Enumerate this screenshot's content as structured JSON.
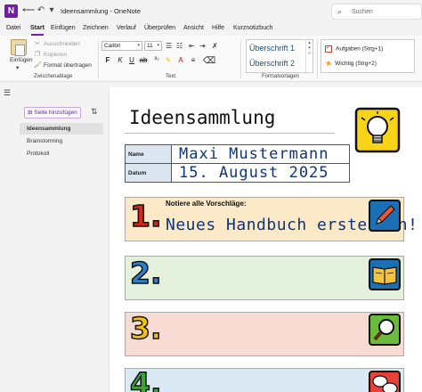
{
  "window": {
    "doc_title": "Ideensammlung - OneNote",
    "search_placeholder": "Suchen"
  },
  "menu": [
    "Datei",
    "Start",
    "Einfügen",
    "Zeichnen",
    "Verlauf",
    "Überprüfen",
    "Ansicht",
    "Hilfe",
    "Kurznotizbuch"
  ],
  "ribbon": {
    "clipboard": {
      "paste": "Einfügen",
      "cut": "Ausschneiden",
      "copy": "Kopieren",
      "format_painter": "Format übertragen",
      "label": "Zwischenablage"
    },
    "text": {
      "font": "Calibri",
      "size": "11",
      "label": "Text"
    },
    "styles": {
      "h1": "Überschrift 1",
      "h2": "Überschrift 2",
      "label": "Formatvorlagen"
    },
    "tags": {
      "todo": "Aufgaben (Strg+1)",
      "important": "Wichtig (Strg+2)"
    }
  },
  "sidebar": {
    "add_page": "Seite hinzufügen",
    "pages": [
      "Ideensammlung",
      "Brainstorming",
      "Protokoll"
    ]
  },
  "page": {
    "title": "Ideensammlung",
    "info": {
      "name_label": "Name",
      "name_value": "Maxi Mustermann",
      "date_label": "Datum",
      "date_value": "15. August 2025"
    },
    "bands": [
      {
        "number": "1.",
        "heading": "Notiere alle Vorschläge:",
        "idea": "Neues Handbuch erstellen!",
        "color": "#fbe9c7",
        "num_color": "#d62718",
        "icon": "pencil-icon"
      },
      {
        "number": "2.",
        "color": "#e3f1dc",
        "num_color": "#2f7fd0",
        "icon": "book-icon"
      },
      {
        "number": "3.",
        "color": "#f8dcd3",
        "num_color": "#f4c20d",
        "icon": "magnifier-icon"
      },
      {
        "number": "4.",
        "color": "#dbe9f5",
        "num_color": "#3aa53a",
        "icon": "speech-bubble-icon"
      }
    ]
  }
}
